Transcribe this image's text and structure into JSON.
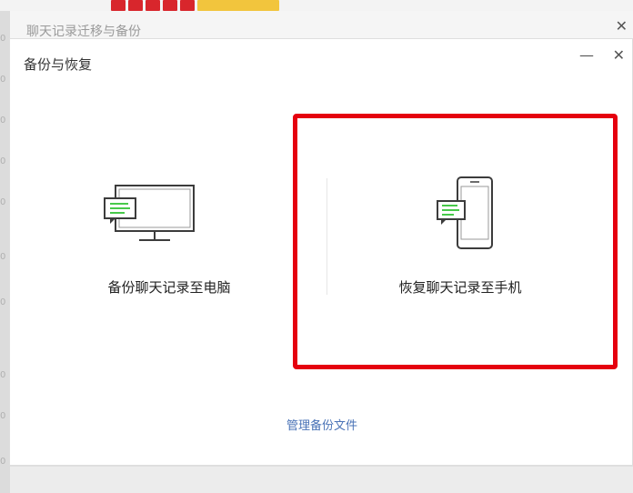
{
  "outer_dialog": {
    "title": "聊天记录迁移与备份",
    "close_glyph": "✕"
  },
  "dialog": {
    "title": "备份与恢复",
    "minimize_glyph": "—",
    "close_glyph": "✕"
  },
  "options": [
    {
      "label": "备份聊天记录至电脑",
      "icon": "computer-chat-icon"
    },
    {
      "label": "恢复聊天记录至手机",
      "icon": "phone-chat-icon"
    }
  ],
  "manage_link": "管理备份文件",
  "left_edge_digits": [
    "0",
    "0",
    "0",
    "0",
    "0",
    "0",
    "0",
    "0",
    "0",
    "0"
  ],
  "colors": {
    "highlight": "#e5000f",
    "link": "#4a73b7",
    "chat_icon_green": "#47c94a"
  }
}
